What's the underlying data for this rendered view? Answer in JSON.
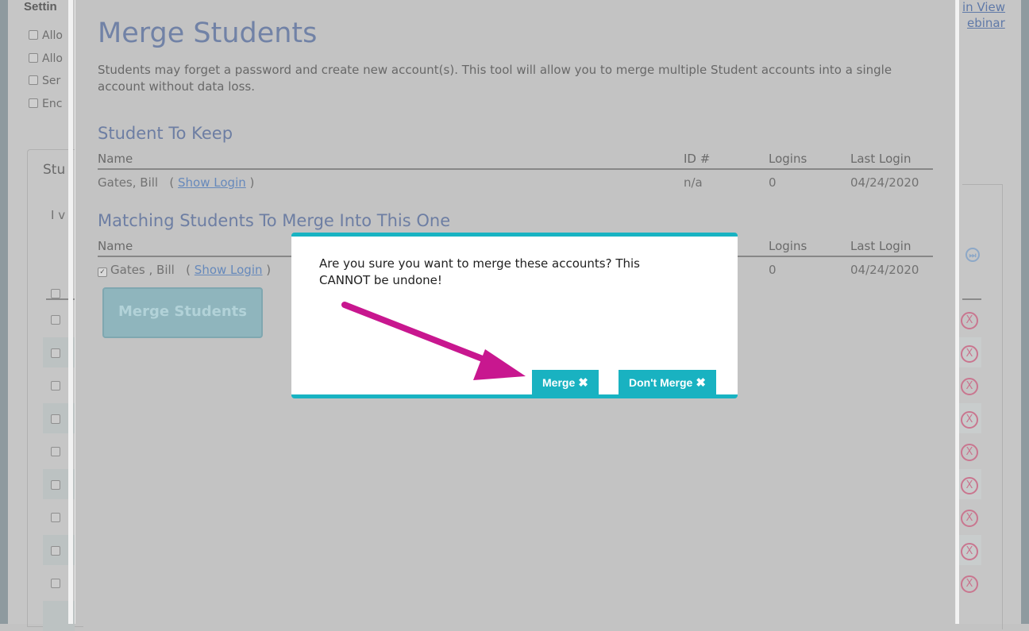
{
  "background": {
    "settings_label": "Settin",
    "options": [
      "Allo",
      "Allo",
      "Ser",
      "Enc"
    ],
    "links": [
      "in View",
      "ebinar"
    ],
    "panel_title": "Stu",
    "panel_text": "I v"
  },
  "modal": {
    "title": "Merge Students",
    "description": "Students may forget a password and create new account(s). This tool will allow you to merge multiple Student accounts into a single account without data loss.",
    "keep_section": {
      "heading": "Student To Keep",
      "columns": [
        "Name",
        "ID #",
        "Logins",
        "Last Login"
      ],
      "row": {
        "name": "Gates, Bill",
        "open_paren": "(",
        "show_login": "Show Login",
        "close_paren": ")",
        "id": "n/a",
        "logins": "0",
        "last_login": "04/24/2020"
      }
    },
    "matching_section": {
      "heading": "Matching Students To Merge Into This One",
      "columns": [
        "Name",
        "Logins",
        "Last Login"
      ],
      "row": {
        "checked": true,
        "check_glyph": "✓",
        "name": "Gates , Bill",
        "open_paren": "(",
        "show_login": "Show Login",
        "close_paren": ")",
        "logins": "0",
        "last_login": "04/24/2020"
      }
    },
    "merge_button_label": "Merge Students"
  },
  "confirm_dialog": {
    "message": "Are you sure you want to merge these accounts? This CANNOT be undone!",
    "merge_label": "Merge",
    "dont_merge_label": "Don't Merge",
    "close_glyph": "✖",
    "accent_color": "#18b3c2"
  },
  "annotation": {
    "arrow_color": "#c8178f"
  },
  "icons": {
    "nav": "next-page-icon",
    "delete": "delete-circle-x-icon",
    "delete_glyph": "X",
    "nav_glyph": "⏭"
  }
}
